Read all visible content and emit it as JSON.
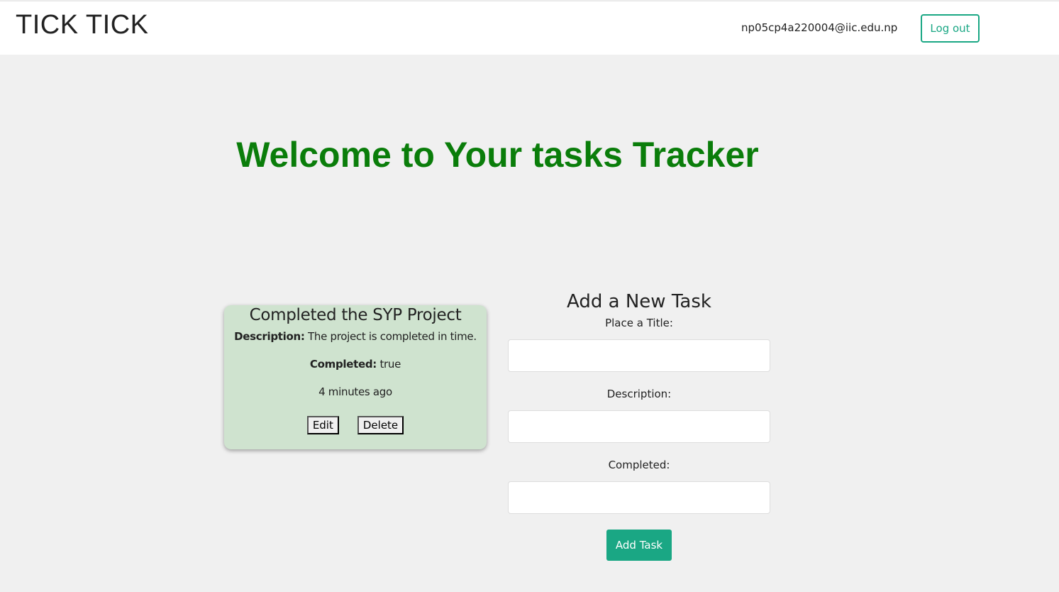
{
  "header": {
    "logo": "TICK TICK",
    "email": "np05cp4a220004@iic.edu.np",
    "logout_label": "Log out"
  },
  "welcome": "Welcome to Your tasks Tracker",
  "tasks": [
    {
      "title": "Completed the SYP Project",
      "description_label": "Description:",
      "description": "The project is completed in time.",
      "completed_label": "Completed:",
      "completed": "true",
      "time": "4 minutes ago",
      "edit_label": "Edit",
      "delete_label": "Delete"
    }
  ],
  "form": {
    "heading": "Add a New Task",
    "title_label": "Place a Title:",
    "title_value": "",
    "description_label": "Description:",
    "description_value": "",
    "completed_label": "Completed:",
    "completed_value": "",
    "submit_label": "Add Task"
  },
  "colors": {
    "accent": "#1aa784",
    "welcome": "#0a7d0a",
    "card": "#cfe3cf"
  }
}
